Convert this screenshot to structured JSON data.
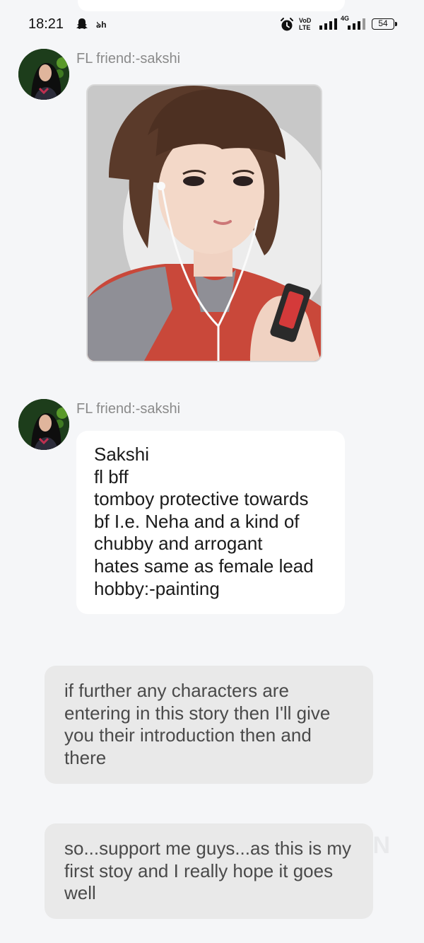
{
  "status_bar": {
    "time": "18:21",
    "small_glyph": "ঌh",
    "volte": [
      "VoD",
      "LTE"
    ],
    "network": "4G",
    "battery": "54",
    "icons": [
      "snapchat-icon",
      "alarm-icon",
      "signal-icon",
      "battery-icon"
    ]
  },
  "messages": [
    {
      "sender": "FL friend:-sakshi",
      "type": "image",
      "image_alt": "illustration of a girl with short brown hair and earphones holding a music player"
    },
    {
      "sender": "FL friend:-sakshi",
      "type": "text",
      "lines": [
        "Sakshi",
        "fl bff",
        "tomboy protective towards",
        "bf I.e. Neha and a kind of",
        "chubby and arrogant",
        "hates same as female lead",
        "hobby:-painting"
      ]
    }
  ],
  "author_notes": [
    "if further any characters are entering in this story then I'll give you their introduction then and there",
    "so...support me guys...as this is my first stoy and I really hope it goes well"
  ],
  "watermark": "ON",
  "colors": {
    "background": "#f5f6f8",
    "bubble_white": "#ffffff",
    "bubble_grey": "#e9e9e9",
    "sender_text": "#8a8a8a"
  }
}
